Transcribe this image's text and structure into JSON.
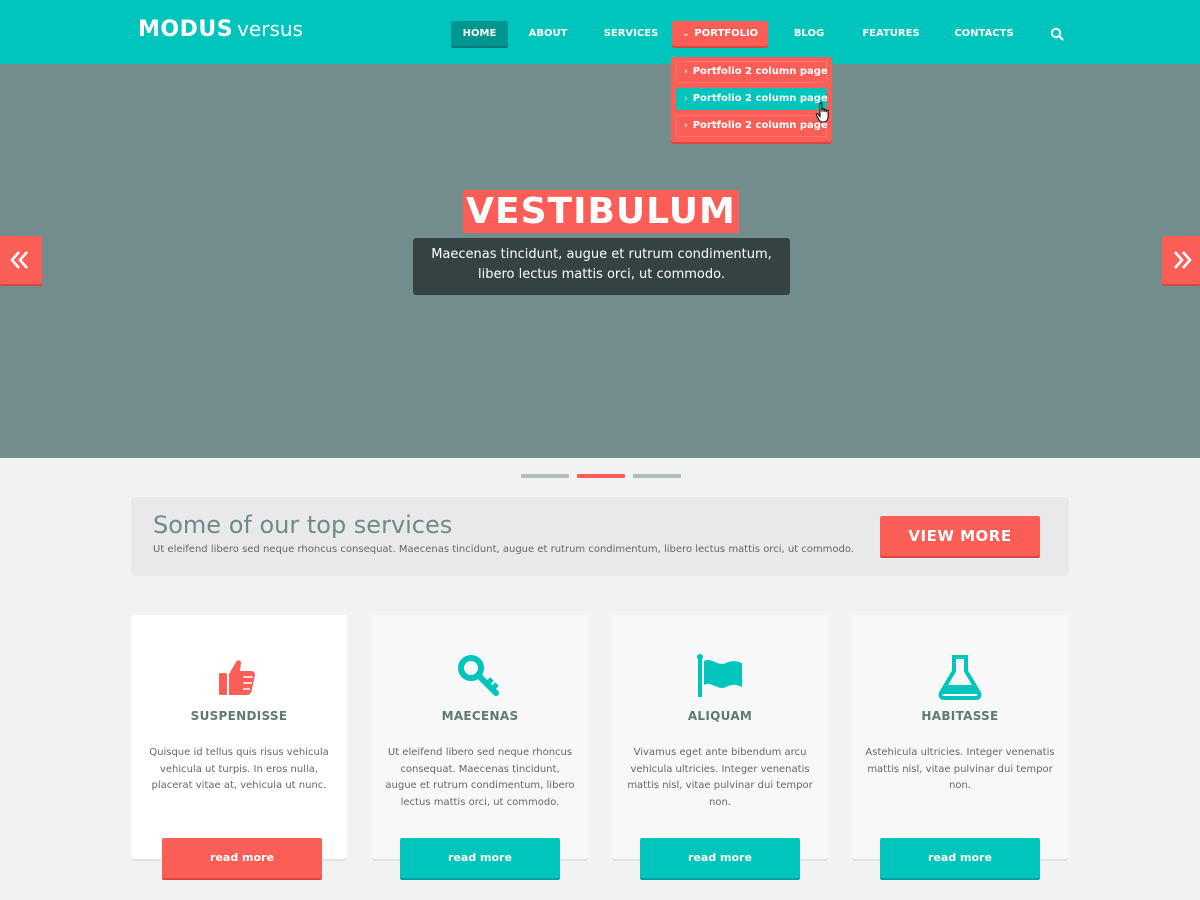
{
  "logo": {
    "bold": "MODUS",
    "light": "versus"
  },
  "nav": {
    "items": [
      {
        "label": "HOME"
      },
      {
        "label": "ABOUT"
      },
      {
        "label": "SERVICES"
      },
      {
        "label": "PORTFOLIO",
        "icon": "chevron-down-icon"
      },
      {
        "label": "BLOG"
      },
      {
        "label": "FEATURES"
      },
      {
        "label": "CONTACTS"
      }
    ],
    "search_icon": "search-icon",
    "active": "HOME",
    "open_dropdown": "PORTFOLIO"
  },
  "dropdown": {
    "items": [
      {
        "label": "Portfolio 2 column page"
      },
      {
        "label": "Portfolio 2 column page"
      },
      {
        "label": "Portfolio 2 column page"
      }
    ],
    "highlighted_index": 1
  },
  "hero": {
    "title": "VESTIBULUM",
    "caption_line1": "Maecenas tincidunt, augue et rutrum condimentum,",
    "caption_line2": "libero lectus mattis orci, ut commodo.",
    "prev_icon": "double-chevron-left-icon",
    "next_icon": "double-chevron-right-icon",
    "slide_count": 3,
    "active_slide": 2
  },
  "banner": {
    "title": "Some of our top services",
    "text": "Ut eleifend libero sed neque rhoncus consequat. Maecenas tincidunt, augue et rutrum condimentum, libero lectus mattis orci, ut commodo.",
    "button": "VIEW MORE"
  },
  "cards": [
    {
      "icon": "thumbs-up-icon",
      "title": "SUSPENDISSE",
      "text": "Quisque id tellus quis risus vehicula vehicula ut turpis. In eros nulla, placerat vitae at, vehicula ut nunc.",
      "button": "read more"
    },
    {
      "icon": "key-icon",
      "title": "MAECENAS",
      "text": "Ut eleifend libero sed neque rhoncus consequat. Maecenas tincidunt, augue et rutrum condimentum, libero lectus mattis orci, ut commodo.",
      "button": "read more"
    },
    {
      "icon": "flag-icon",
      "title": "ALIQUAM",
      "text": "Vivamus eget ante bibendum arcu vehicula ultricies. Integer venenatis mattis nisl, vitae pulvinar dui tempor non.",
      "button": "read more"
    },
    {
      "icon": "flask-icon",
      "title": "HABITASSE",
      "text": "Astehicula ultricies. Integer venenatis mattis nisl, vitae pulvinar dui tempor non.",
      "button": "read more"
    }
  ],
  "colors": {
    "brand_teal": "#00c5bd",
    "accent_coral": "#fb5e57",
    "hero_bg": "#738d8c",
    "caption_bg": "#344342"
  }
}
